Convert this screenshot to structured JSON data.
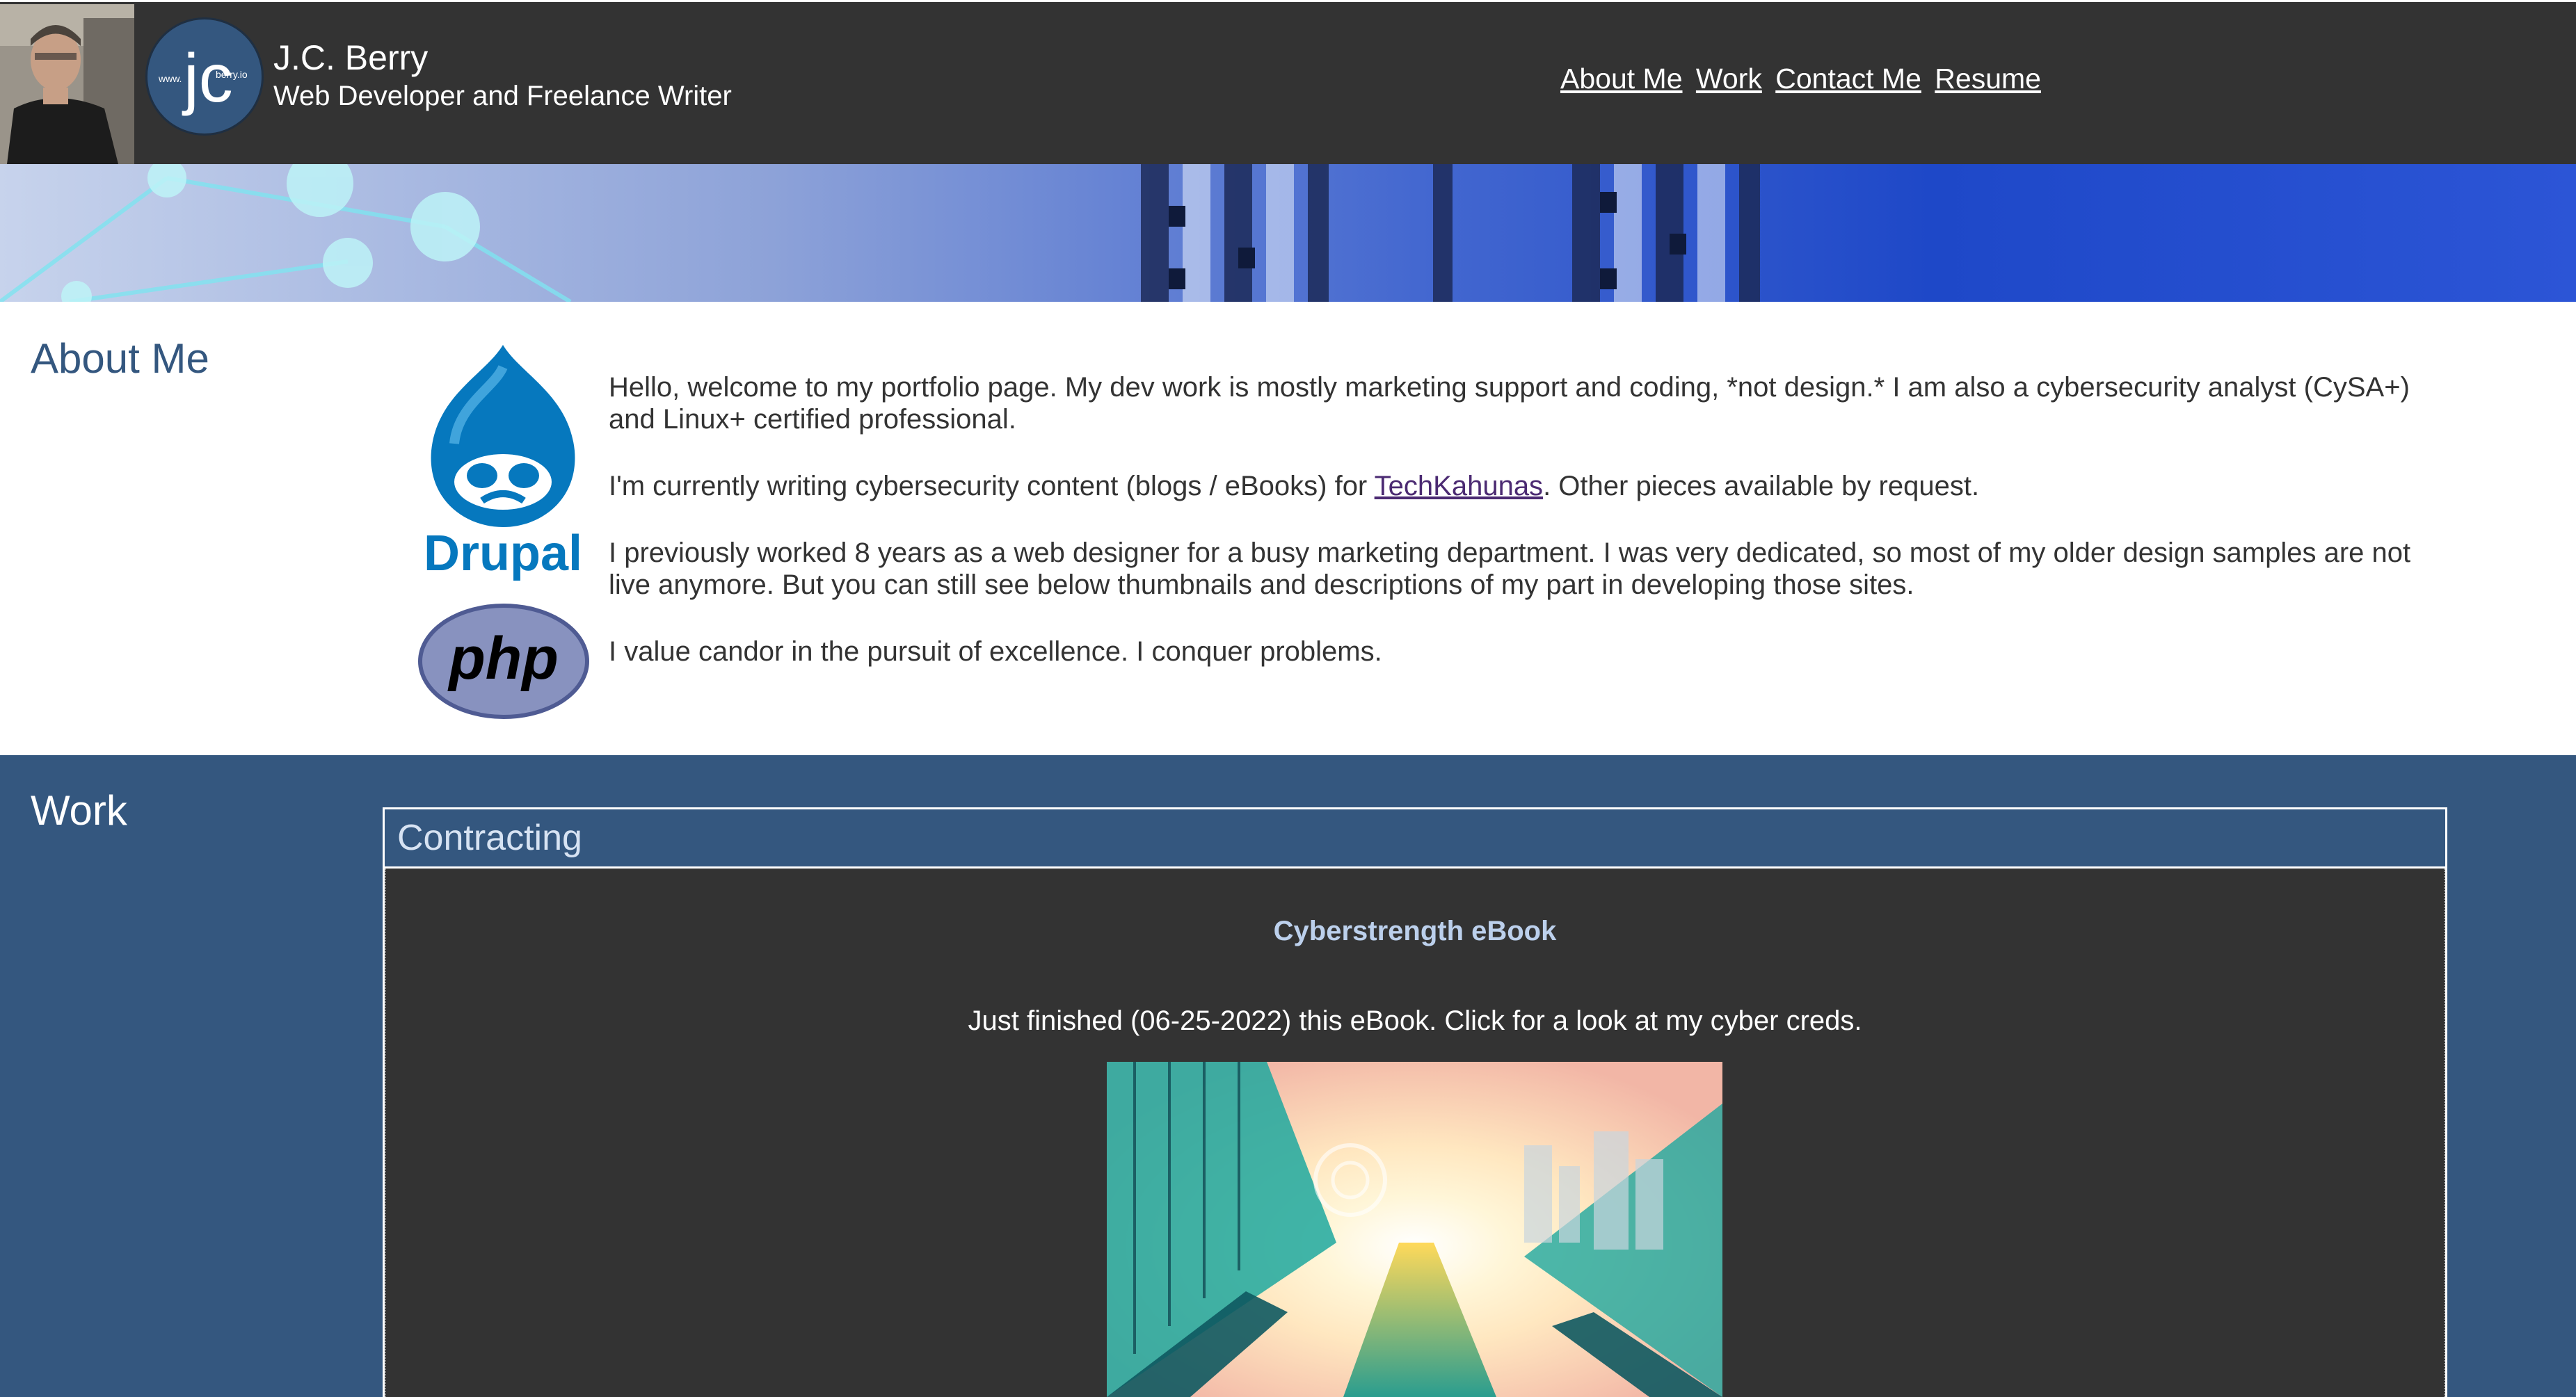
{
  "header": {
    "name": "J.C. Berry",
    "tagline": "Web Developer and Freelance Writer",
    "logo_initials": "jc",
    "logo_left_text": "www.",
    "logo_right_text": "berry.io",
    "nav": [
      {
        "label": "About Me"
      },
      {
        "label": "Work"
      },
      {
        "label": "Contact Me"
      },
      {
        "label": "Resume"
      }
    ]
  },
  "about": {
    "title": "About Me",
    "paragraphs": {
      "p1": "Hello, welcome to my portfolio page. My dev work is mostly marketing support and coding, *not design.* I am also a cybersecurity analyst (CySA+) and Linux+ certified professional.",
      "p2_before": "I'm currently writing cybersecurity content (blogs / eBooks) for ",
      "p2_link": "TechKahunas",
      "p2_after": ". Other pieces available by request.",
      "p3": "I previously worked 8 years as a web designer for a busy marketing department. I was very dedicated, so most of my older design samples are not live anymore. But you can still see below thumbnails and descriptions of my part in developing those sites.",
      "p4": "I value candor in the pursuit of excellence. I conquer problems."
    },
    "drupal_logo_text": "Drupal",
    "php_logo_text": "php"
  },
  "work": {
    "title": "Work",
    "section_heading": "Contracting",
    "item_title": "Cyberstrength eBook",
    "item_description": "Just finished (06-25-2022) this eBook. Click for a look at my cyber creds."
  },
  "colors": {
    "header_bg": "#333333",
    "brand_blue": "#34577f",
    "drupal_blue": "#0678be",
    "php_purple": "#8892bf",
    "link_visited": "#4b2a72"
  }
}
